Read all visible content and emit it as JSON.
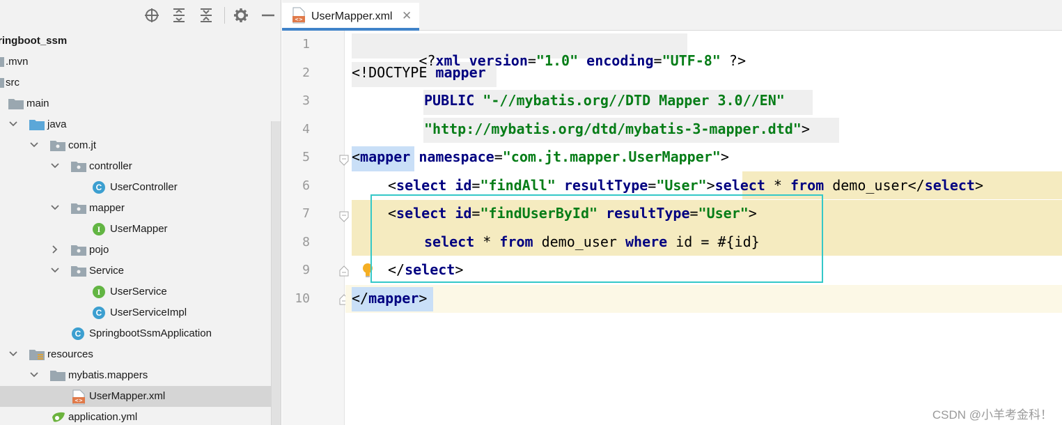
{
  "project_tree": {
    "items": [
      {
        "label": "ringboot_ssm",
        "icon": "module-icon"
      },
      {
        "label": ".mvn",
        "icon": "folder-icon"
      },
      {
        "label": "src",
        "icon": "folder-icon"
      },
      {
        "label": "main",
        "icon": "folder-icon"
      },
      {
        "label": "java",
        "icon": "source-folder-icon"
      },
      {
        "label": "com.jt",
        "icon": "package-icon"
      },
      {
        "label": "controller",
        "icon": "package-icon"
      },
      {
        "label": "UserController",
        "icon": "class-icon",
        "badge": "C"
      },
      {
        "label": "mapper",
        "icon": "package-icon"
      },
      {
        "label": "UserMapper",
        "icon": "interface-icon",
        "badge": "I"
      },
      {
        "label": "pojo",
        "icon": "package-icon"
      },
      {
        "label": "Service",
        "icon": "package-icon"
      },
      {
        "label": "UserService",
        "icon": "interface-icon",
        "badge": "I"
      },
      {
        "label": "UserServiceImpl",
        "icon": "class-icon",
        "badge": "C"
      },
      {
        "label": "SpringbootSsmApplication",
        "icon": "spring-boot-class-icon",
        "badge": "C"
      },
      {
        "label": "resources",
        "icon": "resources-folder-icon"
      },
      {
        "label": "mybatis.mappers",
        "icon": "folder-icon"
      },
      {
        "label": "UserMapper.xml",
        "icon": "xml-file-icon"
      },
      {
        "label": "application.yml",
        "icon": "yaml-spring-icon"
      }
    ]
  },
  "editor": {
    "tab": {
      "label": "UserMapper.xml",
      "close": "✕"
    },
    "line_numbers": [
      "1",
      "2",
      "3",
      "4",
      "5",
      "6",
      "7",
      "8",
      "9",
      "10"
    ],
    "lines": [
      {
        "p1": "<?",
        "p2": "xml version",
        "p3": "=",
        "p4": "\"1.0\"",
        "p5": " encoding",
        "p6": "=",
        "p7": "\"UTF-8\"",
        "p8": " ?>"
      },
      {
        "p1": "<!DOCTYPE ",
        "p2": "mapper"
      },
      {
        "p1": "PUBLIC ",
        "p2": "\"-//mybatis.org//DTD Mapper 3.0//EN\""
      },
      {
        "p1": "\"http://mybatis.org/dtd/mybatis-3-mapper.dtd\"",
        "p2": ">"
      },
      {
        "p1": "<",
        "p2": "mapper",
        "p3": " namespace",
        "p4": "=",
        "p5": "\"com.jt.mapper.UserMapper\"",
        "p6": ">"
      },
      {
        "p1": "<",
        "p2": "select",
        "p3": " id",
        "p4": "=",
        "p5": "\"findAll\"",
        "p6": " resultType",
        "p7": "=",
        "p8": "\"User\"",
        "p9": ">",
        "p10": "select",
        "p11": " * ",
        "p12": "from",
        "p13": " demo_user",
        "p14": "</",
        "p15": "select",
        "p16": ">"
      },
      {
        "p1": "<",
        "p2": "select",
        "p3": " id",
        "p4": "=",
        "p5": "\"findUserById\"",
        "p6": " resultType",
        "p7": "=",
        "p8": "\"User\"",
        "p9": ">"
      },
      {
        "p1": "select",
        "p2": " * ",
        "p3": "from",
        "p4": " demo_user ",
        "p5": "where",
        "p6": " id = #{id}"
      },
      {
        "p1": "</",
        "p2": "select",
        "p3": ">"
      },
      {
        "p1": "</",
        "p2": "mapper",
        "p3": ">"
      }
    ]
  },
  "watermark": "CSDN @小羊考金科！",
  "colors": {
    "tag": "#000080",
    "string": "#067d17",
    "caret_row": "#fcf8e6",
    "sql_injection": "#f5ebc0",
    "tag_match": "#c9dff7",
    "selection_border": "#34c8c8"
  }
}
